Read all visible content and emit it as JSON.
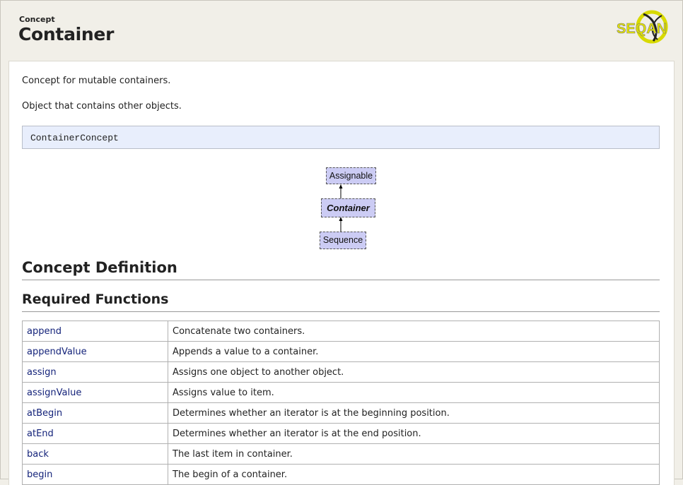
{
  "header": {
    "kind_label": "Concept",
    "title": "Container",
    "logo_text": "SEQAN"
  },
  "intro": {
    "short": "Concept for mutable containers.",
    "long": "Object that contains other objects."
  },
  "signature": "ContainerConcept",
  "diagram": {
    "parent": "Assignable",
    "current": "Container",
    "child": "Sequence"
  },
  "sections": {
    "definition": "Concept Definition",
    "required_functions": "Required Functions"
  },
  "functions": [
    {
      "name": "append",
      "desc": "Concatenate two containers."
    },
    {
      "name": "appendValue",
      "desc": "Appends a value to a container."
    },
    {
      "name": "assign",
      "desc": "Assigns one object to another object."
    },
    {
      "name": "assignValue",
      "desc": "Assigns value to item."
    },
    {
      "name": "atBegin",
      "desc": "Determines whether an iterator is at the beginning position."
    },
    {
      "name": "atEnd",
      "desc": "Determines whether an iterator is at the end position."
    },
    {
      "name": "back",
      "desc": "The last item in container."
    },
    {
      "name": "begin",
      "desc": "The begin of a container."
    }
  ],
  "colors": {
    "page_bg": "#f1efe8",
    "link": "#14237a",
    "signature_bg": "#e8eefc",
    "node_bg": "#ccccf4"
  }
}
